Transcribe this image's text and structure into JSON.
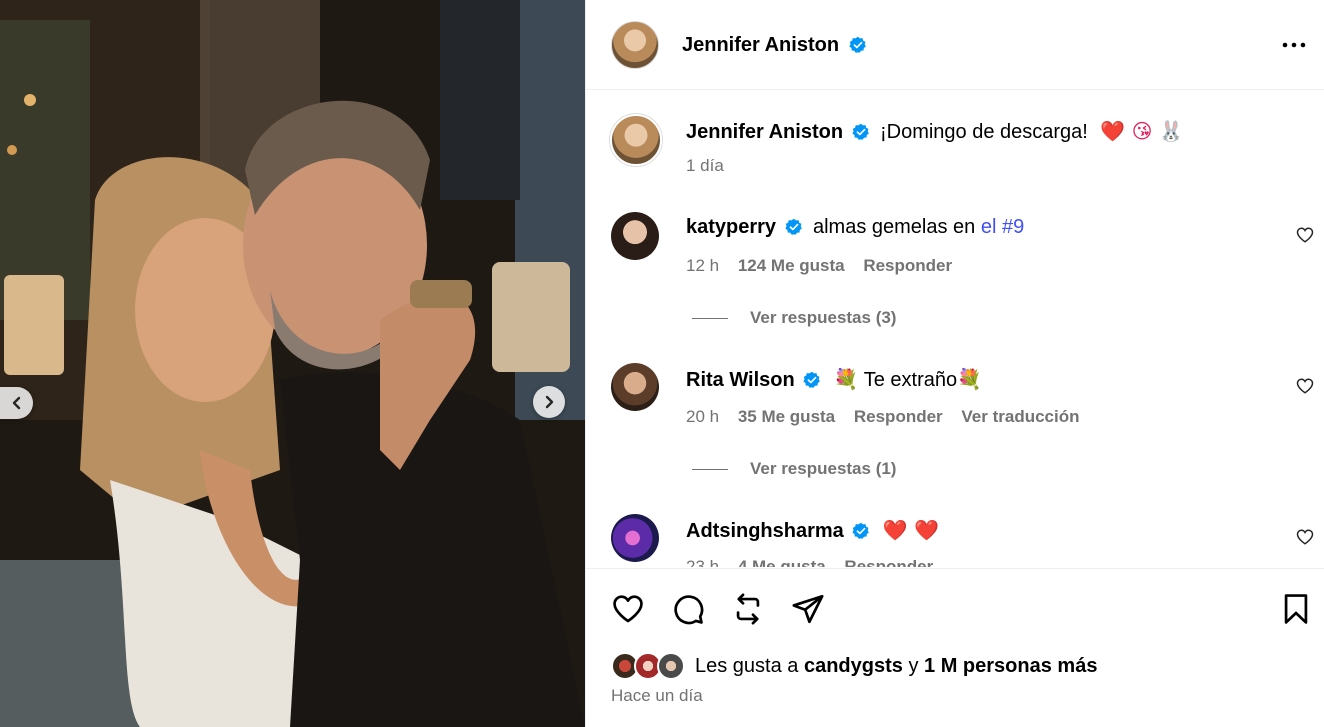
{
  "post": {
    "author": "Jennifer Aniston",
    "caption": "¡Domingo de descarga!",
    "caption_emojis": "❤️ 😘 🐰",
    "caption_age": "1 día",
    "more_icon": "more-horizontal-icon"
  },
  "comments": [
    {
      "username": "katyperry",
      "text": "almas gemelas en ",
      "link_text": "el #9",
      "age": "12 h",
      "likes": "124 Me gusta",
      "reply_label": "Responder",
      "view_replies": "Ver respuestas (3)"
    },
    {
      "username": "Rita Wilson",
      "text_pre": "💐",
      "text": " Te extraño",
      "text_post": "💐",
      "age": "20 h",
      "likes": "35 Me gusta",
      "reply_label": "Responder",
      "translate_label": "Ver traducción",
      "view_replies": "Ver respuestas (1)"
    },
    {
      "username": "Adtsinghsharma",
      "text": "❤️ ❤️",
      "age": "23 h",
      "likes": "4 Me gusta",
      "reply_label": "Responder"
    }
  ],
  "actions": {
    "icons": [
      "heart-icon",
      "comment-icon",
      "repost-icon",
      "share-icon",
      "bookmark-icon"
    ]
  },
  "likes": {
    "prefix": "Les gusta a ",
    "user": "candygsts",
    "connector": " y ",
    "others": "1 M personas más"
  },
  "posted": "Hace un día",
  "colors": {
    "verified": "#0095f6",
    "link": "#4150f7",
    "secondary_text": "#737373",
    "divider": "#efefef"
  }
}
